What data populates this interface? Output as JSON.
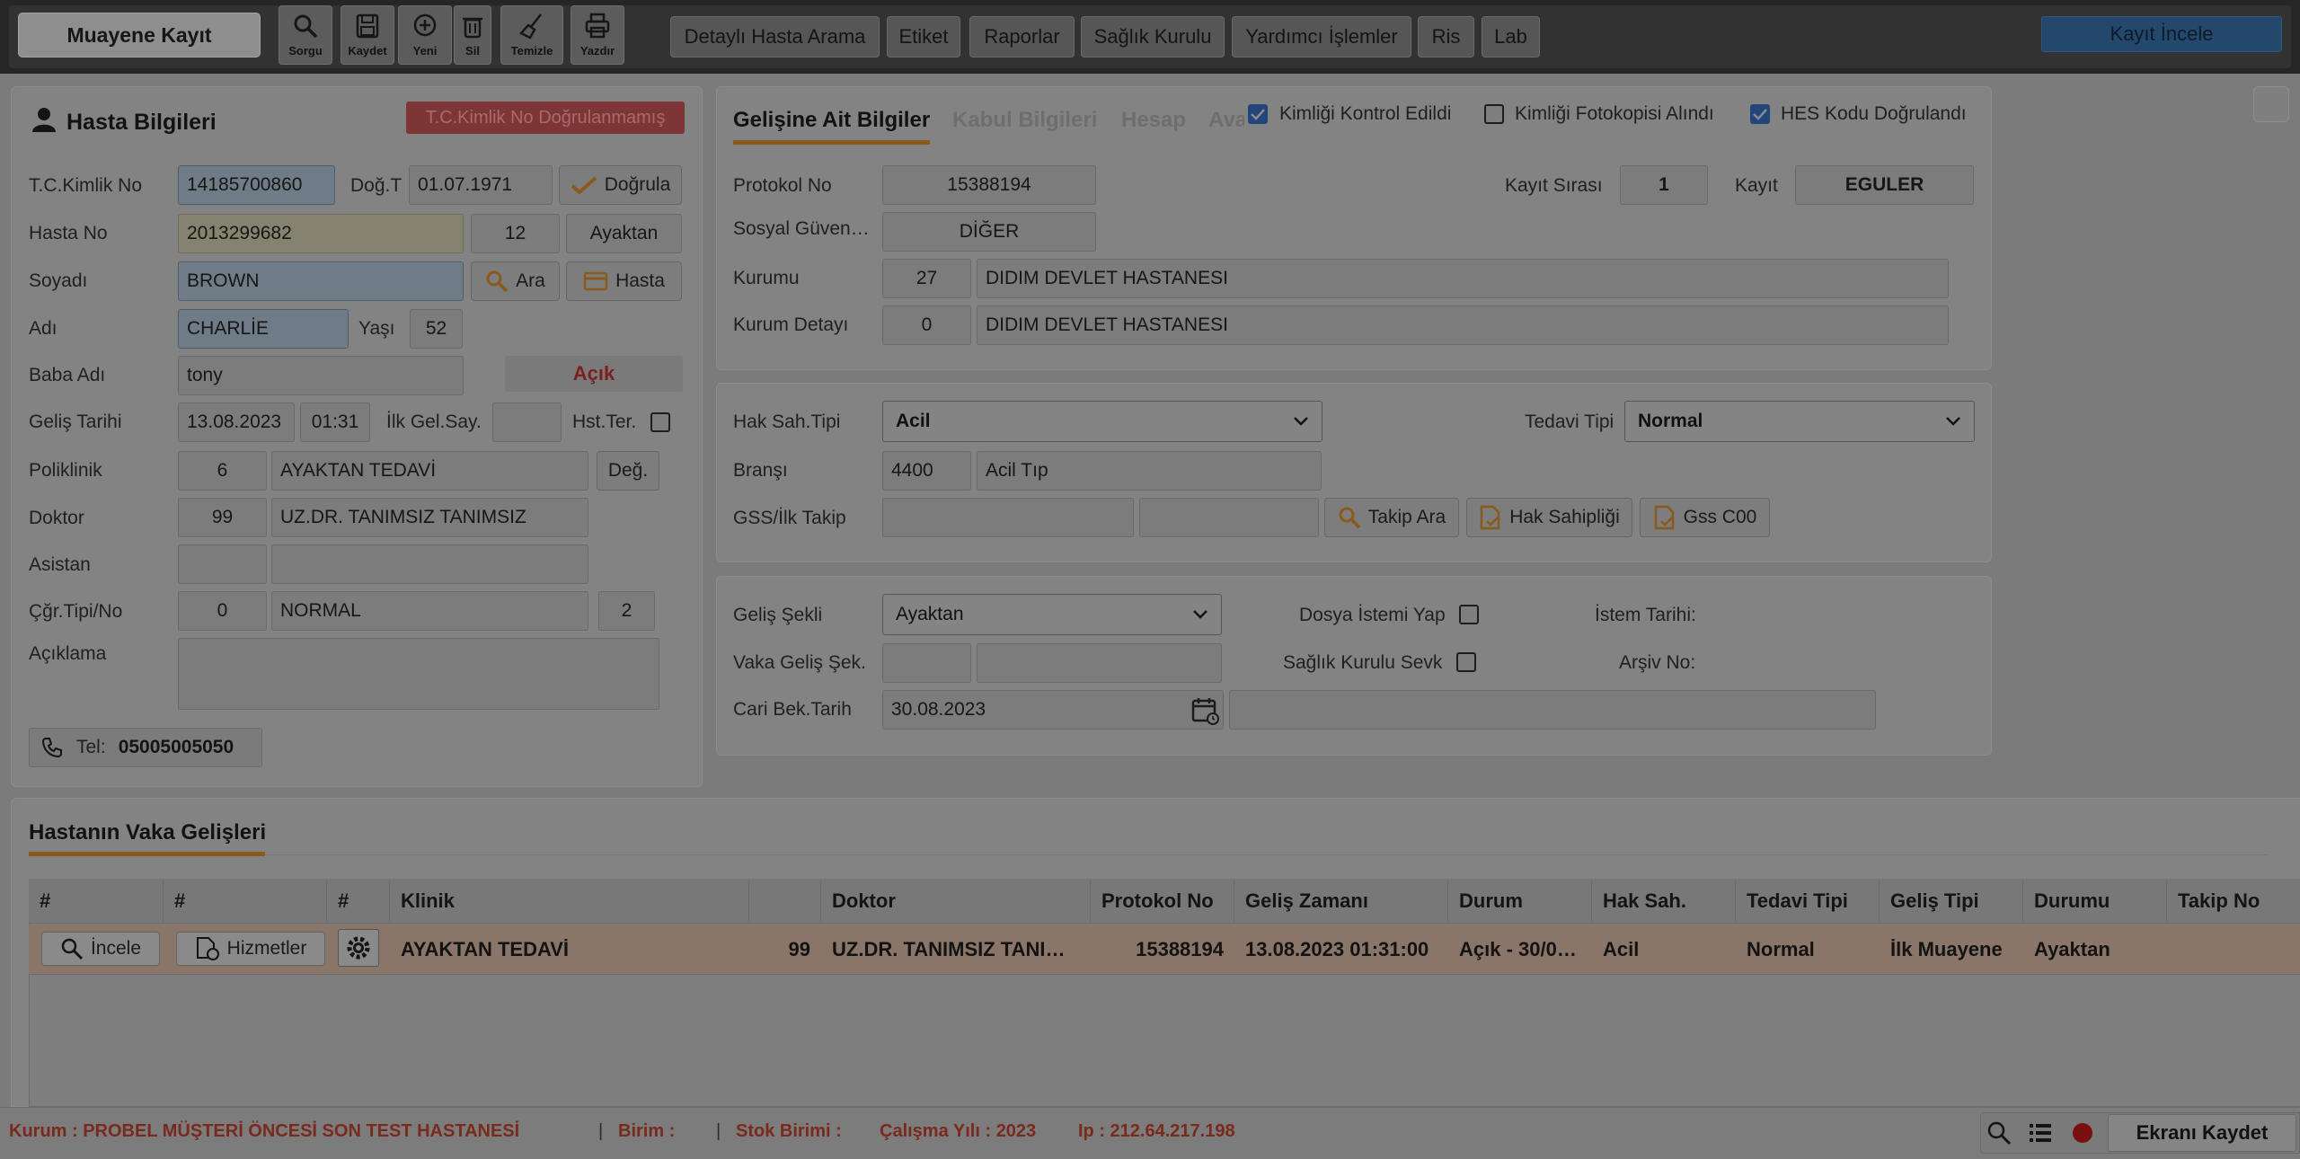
{
  "topbar": {
    "main_button": "Muayene Kayıt",
    "icons": [
      {
        "name": "search-icon",
        "label": "Sorgu"
      },
      {
        "name": "save-icon",
        "label": "Kaydet"
      },
      {
        "name": "plus-circle-icon",
        "label": "Yeni"
      },
      {
        "name": "trash-icon",
        "label": "Sil"
      },
      {
        "name": "broom-icon",
        "label": "Temizle"
      },
      {
        "name": "printer-icon",
        "label": "Yazdır"
      }
    ],
    "menu": [
      "Detaylı Hasta Arama",
      "Etiket",
      "Raporlar",
      "Sağlık Kurulu",
      "Yardımcı İşlemler",
      "Ris",
      "Lab"
    ],
    "right_button": "Kayıt İncele"
  },
  "patient": {
    "title": "Hasta Bilgileri",
    "tc_warning": "T.C.Kimlik No Doğrulanmamış",
    "labels": {
      "tc": "T.C.Kimlik No",
      "dogt": "Doğ.T",
      "hasta_no": "Hasta No",
      "soyadi": "Soyadı",
      "adi": "Adı",
      "yasi": "Yaşı",
      "baba": "Baba Adı",
      "gelis": "Geliş Tarihi",
      "ilk_gel": "İlk Gel.Say.",
      "hst_ter": "Hst.Ter.",
      "poliklinik": "Poliklinik",
      "doktor": "Doktor",
      "asistan": "Asistan",
      "cgr": "Çğr.Tipi/No",
      "aciklama": "Açıklama"
    },
    "tc_no": "14185700860",
    "dogum_tarihi": "01.07.1971",
    "dogrula_label": "Doğrula",
    "hasta_no": "2013299682",
    "hasta_no_extra": "12",
    "hasta_type": "Ayaktan",
    "soyadi": "BROWN",
    "ara_label": "Ara",
    "hasta_label": "Hasta",
    "adi": "CHARLİE",
    "yasi": "52",
    "baba_adi": "tony",
    "durum": "Açık",
    "gelis_tarihi": "13.08.2023",
    "gelis_saati": "01:31",
    "ilk_gel_say": "",
    "poliklinik_kod": "6",
    "poliklinik_ad": "AYAKTAN TEDAVİ",
    "deg_label": "Değ.",
    "doktor_kod": "99",
    "doktor_ad": "UZ.DR. TANIMSIZ TANIMSIZ",
    "asistan_kod": "",
    "asistan_ad": "",
    "cagri_kod": "0",
    "cagri_ad": "NORMAL",
    "cagri_no": "2",
    "aciklama": "",
    "tel_label": "Tel:",
    "tel": "05005005050"
  },
  "gelis": {
    "tabs": [
      "Gelişine Ait Bilgiler",
      "Kabul Bilgileri",
      "Hesap",
      "Ava"
    ],
    "checks": [
      {
        "label": "Kimliği Kontrol Edildi",
        "checked": true
      },
      {
        "label": "Kimliği Fotokopisi Alındı",
        "checked": false
      },
      {
        "label": "HES Kodu Doğrulandı",
        "checked": true
      }
    ],
    "labels": {
      "protokol": "Protokol No",
      "sosyal": "Sosyal Güven…",
      "kurumu": "Kurumu",
      "kurum_detay": "Kurum Detayı",
      "kayit_sirasi": "Kayıt Sırası",
      "kayit": "Kayıt"
    },
    "protokol_no": "15388194",
    "sosyal_guvence": "DİĞER",
    "kurum_kod": "27",
    "kurum_ad": "DIDIM DEVLET HASTANESI",
    "kurum_detay_kod": "0",
    "kurum_detay_ad": "DIDIM DEVLET HASTANESI",
    "kayit_sirasi": "1",
    "kayit_user": "EGULER"
  },
  "hak": {
    "labels": {
      "hak_sah": "Hak Sah.Tipi",
      "tedavi": "Tedavi Tipi",
      "brans": "Branşı",
      "gss": "GSS/İlk Takip"
    },
    "hak_sah_tipi": "Acil",
    "tedavi_tipi": "Normal",
    "brans_kod": "4400",
    "brans_ad": "Acil Tıp",
    "gss1": "",
    "gss2": "",
    "buttons": [
      "Takip Ara",
      "Hak Sahipliği",
      "Gss C00"
    ]
  },
  "sekil": {
    "labels": {
      "gelis_sekli": "Geliş Şekli",
      "vaka": "Vaka Geliş Şek.",
      "cari": "Cari Bek.Tarih",
      "dosya": "Dosya İstemi Yap",
      "saglik": "Sağlık Kurulu Sevk",
      "istem": "İstem Tarihi:",
      "arsiv": "Arşiv No:"
    },
    "gelis_sekli": "Ayaktan",
    "vaka_kod": "",
    "vaka_ad": "",
    "cari_tarih": "30.08.2023",
    "cari_extra": ""
  },
  "vaka": {
    "title": "Hastanın Vaka Gelişleri",
    "columns": [
      "#",
      "#",
      "#",
      "Klinik",
      "",
      "Doktor",
      "Protokol No",
      "Geliş Zamanı",
      "Durum",
      "Hak Sah.",
      "Tedavi Tipi",
      "Geliş Tipi",
      "Durumu",
      "Takip No"
    ],
    "row": {
      "incele": "İncele",
      "hizmetler": "Hizmetler",
      "klinik": "AYAKTAN TEDAVİ",
      "kod": "99",
      "doktor": "UZ.DR. TANIMSIZ TANI…",
      "protokol": "15388194",
      "gelis_zamani": "13.08.2023 01:31:00",
      "durum": "Açık - 30/0…",
      "hak_sah": "Acil",
      "tedavi": "Normal",
      "gelis_tipi": "İlk Muayene",
      "durumu": "Ayaktan",
      "takip": ""
    }
  },
  "status": {
    "kurum": "Kurum : PROBEL MÜŞTERİ ÖNCESİ SON TEST HASTANESİ",
    "sep": "|",
    "birim": "Birim :",
    "stok": "Stok Birimi :",
    "yil": "Çalışma Yılı : 2023",
    "ip": "Ip : 212.64.217.198",
    "ekrani_kaydet": "Ekranı Kaydet"
  },
  "colors": {
    "accent_orange": "#8a5a1c",
    "danger_red": "#8a2020",
    "row_highlight": "#8a7668"
  }
}
